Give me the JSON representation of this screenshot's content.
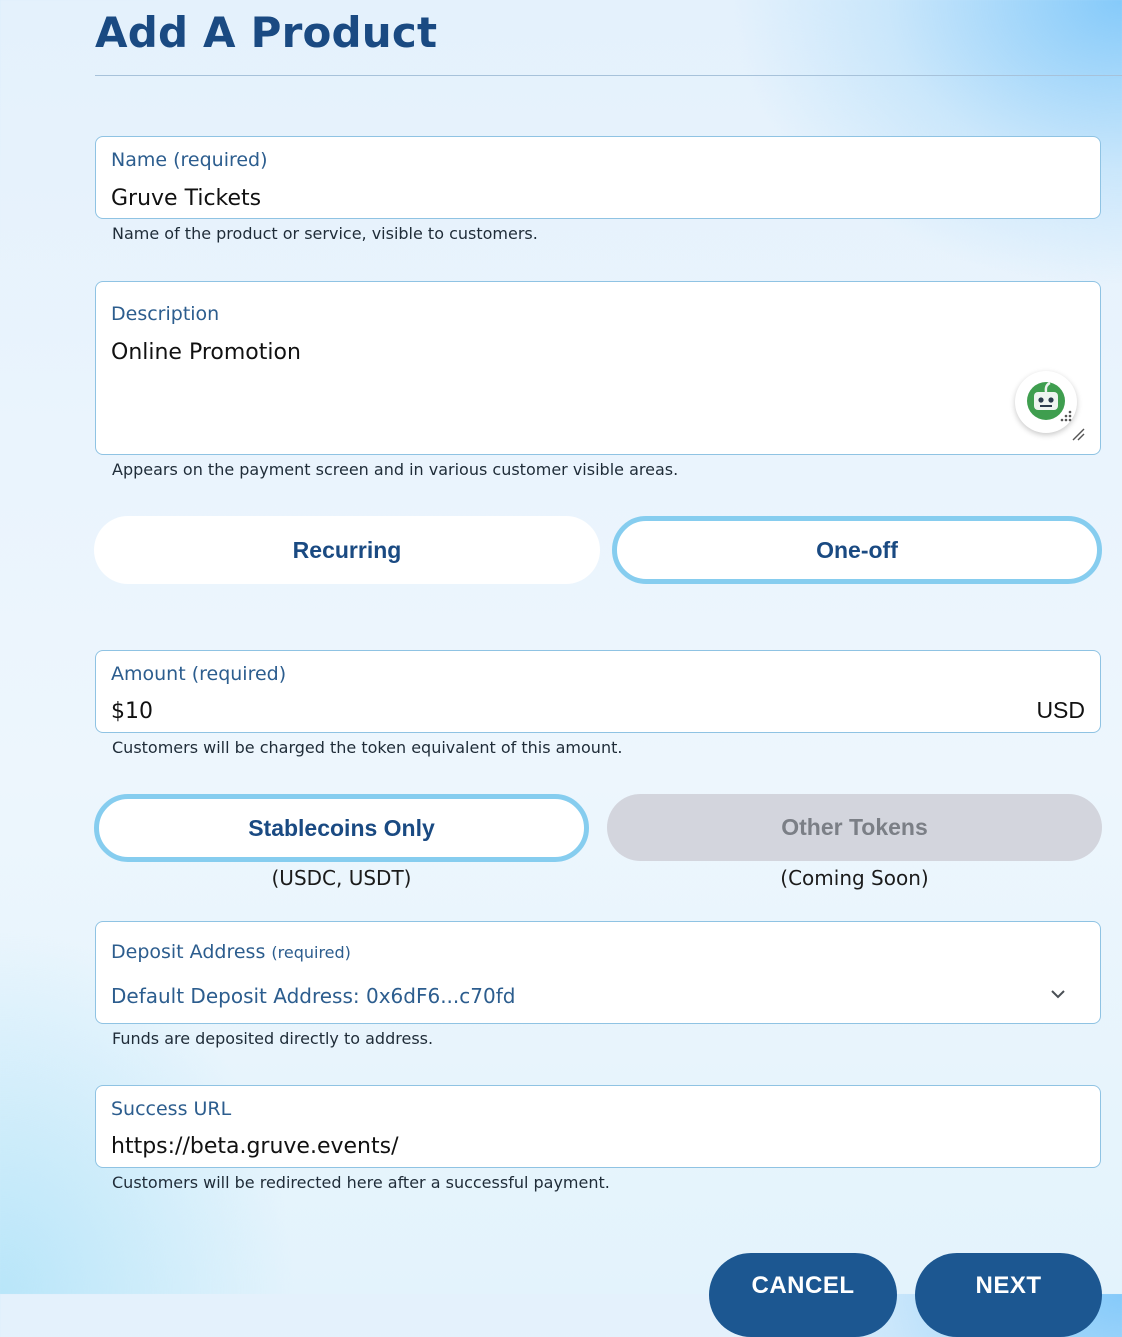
{
  "page": {
    "title": "Add A Product"
  },
  "name_field": {
    "label": "Name (required)",
    "value": "Gruve Tickets",
    "helper": "Name of the product or service, visible to customers."
  },
  "description_field": {
    "label": "Description",
    "value": "Online Promotion",
    "helper": "Appears on the payment screen and in various customer visible areas.",
    "assistant_icon": "robot-assistant-icon"
  },
  "billing_type": {
    "options": [
      "Recurring",
      "One-off"
    ],
    "selected": "One-off"
  },
  "amount_field": {
    "label": "Amount (required)",
    "value": "$10",
    "currency": "USD",
    "helper": "Customers will be charged the token equivalent of this amount."
  },
  "token_type": {
    "stablecoins": {
      "label": "Stablecoins Only",
      "note": "(USDC, USDT)"
    },
    "other": {
      "label": "Other Tokens",
      "note": "(Coming Soon)"
    },
    "selected": "Stablecoins Only"
  },
  "deposit_field": {
    "label": "Deposit Address",
    "label_suffix": "(required)",
    "value": "Default Deposit Address: 0x6dF6...c70fd",
    "helper": "Funds are deposited directly to address."
  },
  "success_url_field": {
    "label": "Success URL",
    "value": "https://beta.gruve.events/",
    "helper": "Customers will be redirected here after a successful payment."
  },
  "actions": {
    "cancel": "CANCEL",
    "next": "NEXT"
  },
  "colors": {
    "brand": "#1a4a82",
    "primary_button": "#1c5791",
    "selected_border": "#86cdef",
    "disabled_bg": "#d3d5dd"
  }
}
